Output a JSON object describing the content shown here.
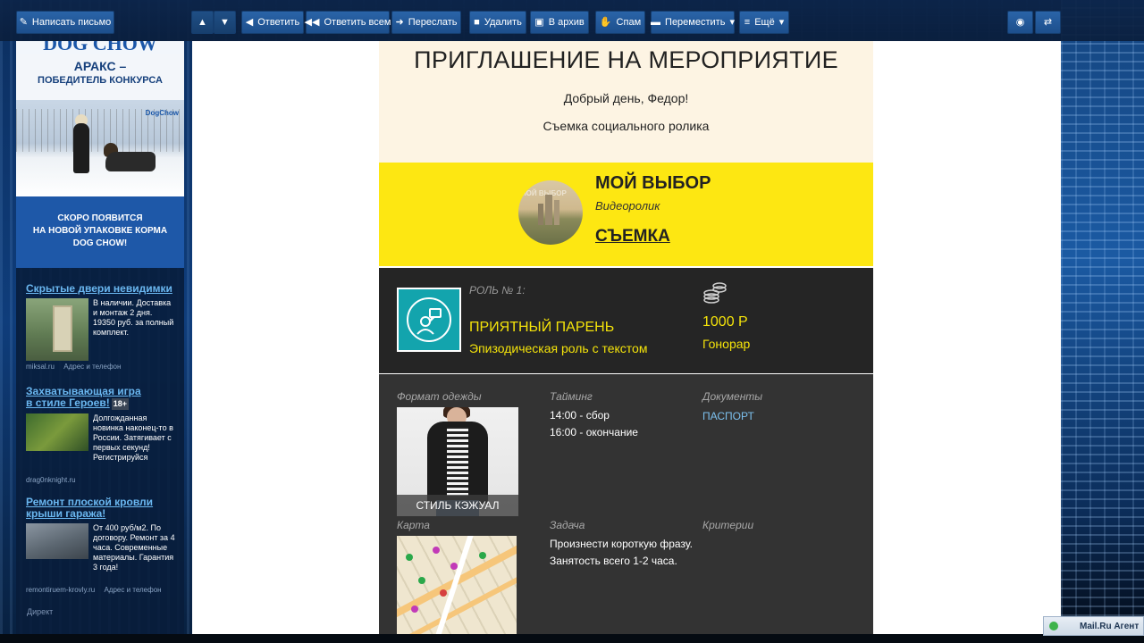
{
  "toolbar": {
    "compose": "Написать письмо",
    "reply": "Ответить",
    "reply_all": "Ответить всем",
    "forward": "Переслать",
    "delete": "Удалить",
    "archive": "В архив",
    "spam": "Спам",
    "move": "Переместить",
    "more": "Ещё"
  },
  "banner": {
    "brand": "DOG CHOW",
    "headline": "АРАКС –",
    "subheadline": "ПОБЕДИТЕЛЬ КОНКУРСА",
    "package_logo": "DogChow",
    "bottom_line1": "СКОРО ПОЯВИТСЯ",
    "bottom_line2": "НА НОВОЙ УПАКОВКЕ КОРМА",
    "bottom_line3": "DOG CHOW!"
  },
  "ads": [
    {
      "title": "Скрытые двери невидимки",
      "text": "В наличии. Доставка и монтаж 2 дня. 19350 руб. за полный комплект.",
      "domain": "miksal.ru",
      "contact": "Адрес и телефон"
    },
    {
      "title_line1": "Захватывающая игра",
      "title_line2": "в стиле Героев!",
      "age": "18+",
      "text": "Долгожданная новинка наконец-то в России. Затягивает с первых секунд! Регистрируйся",
      "domain": "drag0nknight.ru"
    },
    {
      "title_line1": "Ремонт плоской кровли",
      "title_line2": "крыши гаража!",
      "text": "От 400 руб/м2. По договору. Ремонт за 4 часа. Современные материалы. Гарантия 3 года!",
      "domain": "remontiruem-krovly.ru",
      "contact": "Адрес и телефон"
    }
  ],
  "direct_label": "Директ",
  "letter": {
    "title": "ПРИГЛАШЕНИЕ НА МЕРОПРИЯТИЕ",
    "greeting": "Добрый день, Федор!",
    "subtitle": "Съемка социального ролика",
    "project": {
      "name": "МОЙ ВЫБОР",
      "type": "Видеоролик",
      "action": "СЪЕМКА",
      "image_watermark": "МОЙ ВЫБОР"
    },
    "role": {
      "label": "РОЛЬ № 1:",
      "name": "ПРИЯТНЫЙ ПАРЕНЬ",
      "description": "Эпизодическая роль с текстом",
      "fee": "1000 Р",
      "fee_label": "Гонорар"
    },
    "details": {
      "dress_label": "Формат одежды",
      "dress_caption": "СТИЛЬ КЭЖУАЛ",
      "timing_label": "Тайминг",
      "timing_line1": "14:00 - сбор",
      "timing_line2": "16:00 - окончание",
      "docs_label": "Документы",
      "docs_value": "ПАСПОРТ",
      "map_label": "Карта",
      "task_label": "Задача",
      "task_line1": "Произнести короткую фразу.",
      "task_line2": "Занятость всего 1-2 часа.",
      "criteria_label": "Критерии"
    }
  },
  "agent": {
    "label": "Mail.Ru Агент"
  },
  "colors": {
    "accent_yellow": "#fde712",
    "role_yellow": "#f4e30a",
    "teal": "#13a4ad",
    "link_blue": "#7cc0ee",
    "toolbar_blue": "#2a64a8"
  }
}
